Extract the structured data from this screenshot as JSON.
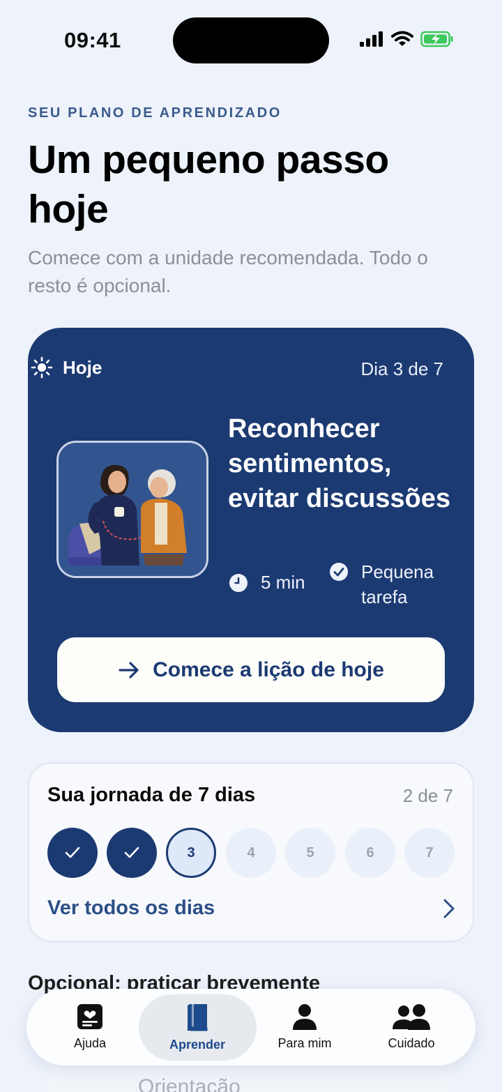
{
  "status_bar": {
    "time": "09:41"
  },
  "header": {
    "eyebrow": "SEU PLANO DE APRENDIZADO",
    "title": "Um pequeno passo hoje",
    "subtitle": "Comece com a unidade recomendada. Todo o resto é opcional."
  },
  "today": {
    "label": "Hoje",
    "day_counter": "Dia 3 de 7",
    "lesson_title": "Reconhecer sentimentos, evitar discussões",
    "duration": "5 min",
    "task": "Pequena tarefa",
    "start_button": "Comece a lição de hoje"
  },
  "journey": {
    "title": "Sua jornada de 7 dias",
    "count": "2 de 7",
    "completed_fraction": 0.2857,
    "days": [
      {
        "label": "",
        "state": "done"
      },
      {
        "label": "",
        "state": "done"
      },
      {
        "label": "3",
        "state": "current"
      },
      {
        "label": "4",
        "state": "future"
      },
      {
        "label": "5",
        "state": "future"
      },
      {
        "label": "6",
        "state": "future"
      },
      {
        "label": "7",
        "state": "future"
      }
    ],
    "see_all": "Ver todos os dias"
  },
  "optional": {
    "heading": "Opcional: praticar brevemente",
    "peek_text": "Orientação"
  },
  "tabs": [
    {
      "label": "Ajuda",
      "icon": "card-heart-icon",
      "active": false
    },
    {
      "label": "Aprender",
      "icon": "book-icon",
      "active": true
    },
    {
      "label": "Para mim",
      "icon": "person-icon",
      "active": false
    },
    {
      "label": "Cuidado",
      "icon": "people-icon",
      "active": false
    }
  ],
  "colors": {
    "primary": "#1c3a72",
    "background": "#eef3fb",
    "accent_text": "#3a5a8c",
    "battery": "#3cc85a"
  }
}
